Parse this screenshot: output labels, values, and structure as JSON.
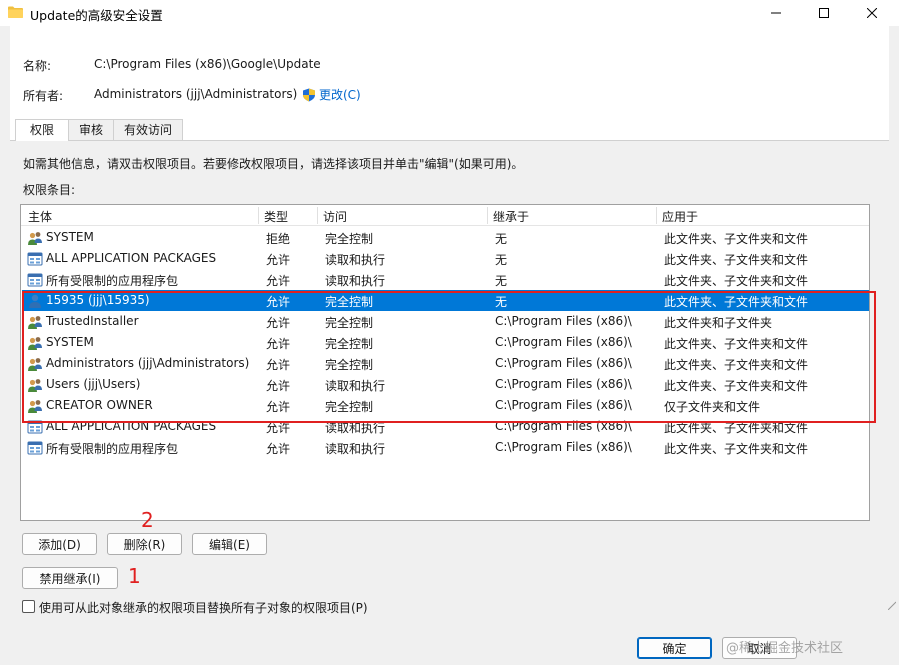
{
  "window": {
    "title": "Update的高级安全设置"
  },
  "fields": {
    "name_label": "名称:",
    "name_value": "C:\\Program Files (x86)\\Google\\Update",
    "owner_label": "所有者:",
    "owner_value": "Administrators (jjj\\Administrators)",
    "change_link": "更改(C)"
  },
  "tabs": [
    {
      "label": "权限",
      "active": true
    },
    {
      "label": "审核",
      "active": false
    },
    {
      "label": "有效访问",
      "active": false
    }
  ],
  "info_text": "如需其他信息，请双击权限项目。若要修改权限项目，请选择该项目并单击\"编辑\"(如果可用)。",
  "entries_label": "权限条目:",
  "columns": [
    "主体",
    "类型",
    "访问",
    "继承于",
    "应用于"
  ],
  "rows": [
    {
      "icon": "user-group-icon",
      "principal": "SYSTEM",
      "type": "拒绝",
      "access": "完全控制",
      "inherited": "无",
      "applies": "此文件夹、子文件夹和文件",
      "selected": false
    },
    {
      "icon": "package-icon",
      "principal": "ALL APPLICATION PACKAGES",
      "type": "允许",
      "access": "读取和执行",
      "inherited": "无",
      "applies": "此文件夹、子文件夹和文件",
      "selected": false
    },
    {
      "icon": "package-icon",
      "principal": "所有受限制的应用程序包",
      "type": "允许",
      "access": "读取和执行",
      "inherited": "无",
      "applies": "此文件夹、子文件夹和文件",
      "selected": false
    },
    {
      "icon": "user-icon",
      "principal": "15935 (jjj\\15935)",
      "type": "允许",
      "access": "完全控制",
      "inherited": "无",
      "applies": "此文件夹、子文件夹和文件",
      "selected": true
    },
    {
      "icon": "user-group-icon",
      "principal": "TrustedInstaller",
      "type": "允许",
      "access": "完全控制",
      "inherited": "C:\\Program Files (x86)\\",
      "applies": "此文件夹和子文件夹",
      "selected": false
    },
    {
      "icon": "user-group-icon",
      "principal": "SYSTEM",
      "type": "允许",
      "access": "完全控制",
      "inherited": "C:\\Program Files (x86)\\",
      "applies": "此文件夹、子文件夹和文件",
      "selected": false
    },
    {
      "icon": "user-group-icon",
      "principal": "Administrators (jjj\\Administrators)",
      "type": "允许",
      "access": "完全控制",
      "inherited": "C:\\Program Files (x86)\\",
      "applies": "此文件夹、子文件夹和文件",
      "selected": false
    },
    {
      "icon": "user-group-icon",
      "principal": "Users (jjj\\Users)",
      "type": "允许",
      "access": "读取和执行",
      "inherited": "C:\\Program Files (x86)\\",
      "applies": "此文件夹、子文件夹和文件",
      "selected": false
    },
    {
      "icon": "user-group-icon",
      "principal": "CREATOR OWNER",
      "type": "允许",
      "access": "完全控制",
      "inherited": "C:\\Program Files (x86)\\",
      "applies": "仅子文件夹和文件",
      "selected": false
    },
    {
      "icon": "package-icon",
      "principal": "ALL APPLICATION PACKAGES",
      "type": "允许",
      "access": "读取和执行",
      "inherited": "C:\\Program Files (x86)\\",
      "applies": "此文件夹、子文件夹和文件",
      "selected": false
    },
    {
      "icon": "package-icon",
      "principal": "所有受限制的应用程序包",
      "type": "允许",
      "access": "读取和执行",
      "inherited": "C:\\Program Files (x86)\\",
      "applies": "此文件夹、子文件夹和文件",
      "selected": false
    }
  ],
  "buttons": {
    "add": "添加(D)",
    "remove": "删除(R)",
    "edit": "编辑(E)",
    "disable_inheritance": "禁用继承(I)",
    "ok": "确定",
    "cancel": "取消"
  },
  "checkbox_label": "使用可从此对象继承的权限项目替换所有子对象的权限项目(P)",
  "annotations": {
    "one": "1",
    "two": "2"
  },
  "watermark": "@稀土掘金技术社区",
  "colors": {
    "selection": "#0078d7",
    "annotation": "#e02020",
    "link": "#0066cc"
  }
}
